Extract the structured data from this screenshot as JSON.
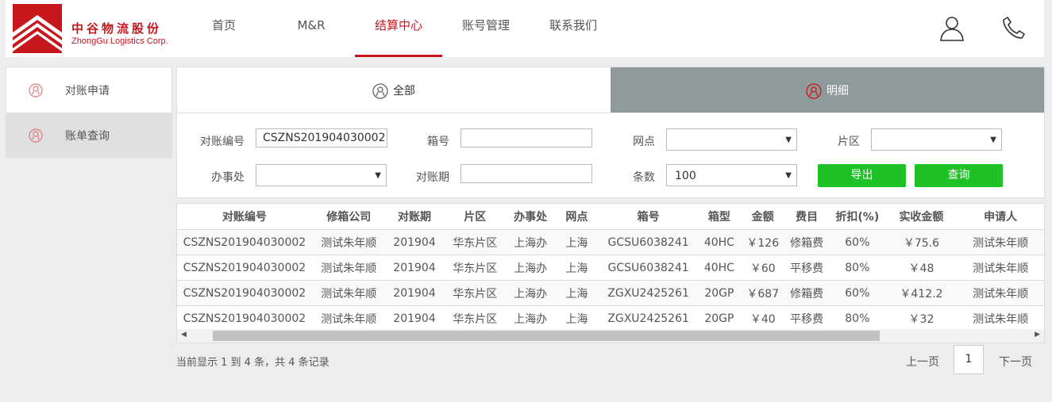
{
  "brand": {
    "name_cn": "中谷物流股份",
    "name_en": "ZhongGu Logistics Corp.",
    "color": "#c8161d"
  },
  "nav": {
    "items": [
      {
        "label": "首页"
      },
      {
        "label": "M&R"
      },
      {
        "label": "结算中心"
      },
      {
        "label": "账号管理"
      },
      {
        "label": "联系我们"
      }
    ],
    "active_index": 2
  },
  "header_icons": [
    "user-icon",
    "phone-icon"
  ],
  "sidebar": {
    "items": [
      {
        "label": "对账申请",
        "icon": "person-icon"
      },
      {
        "label": "账单查询",
        "icon": "person-icon"
      }
    ],
    "active_index": 1
  },
  "tabs": [
    {
      "label": "全部"
    },
    {
      "label": "明细"
    }
  ],
  "active_tab": 1,
  "filters": {
    "recon_no": {
      "label": "对账编号",
      "value": "CSZNS201904030002"
    },
    "box_no": {
      "label": "箱号",
      "value": ""
    },
    "outlet": {
      "label": "网点",
      "value": ""
    },
    "area": {
      "label": "片区",
      "value": ""
    },
    "office": {
      "label": "办事处",
      "value": ""
    },
    "period": {
      "label": "对账期",
      "value": ""
    },
    "count": {
      "label": "条数",
      "value": "100"
    },
    "export_label": "导出",
    "query_label": "查询"
  },
  "table": {
    "columns": [
      "对账编号",
      "修箱公司",
      "对账期",
      "片区",
      "办事处",
      "网点",
      "箱号",
      "箱型",
      "金额",
      "费目",
      "折扣(%)",
      "实收金额",
      "申请人"
    ],
    "rows": [
      [
        "CSZNS201904030002",
        "测试朱年顺",
        "201904",
        "华东片区",
        "上海办",
        "上海",
        "GCSU6038241",
        "40HC",
        "￥126",
        "修箱费",
        "60%",
        "￥75.6",
        "测试朱年顺"
      ],
      [
        "CSZNS201904030002",
        "测试朱年顺",
        "201904",
        "华东片区",
        "上海办",
        "上海",
        "GCSU6038241",
        "40HC",
        "￥60",
        "平移费",
        "80%",
        "￥48",
        "测试朱年顺"
      ],
      [
        "CSZNS201904030002",
        "测试朱年顺",
        "201904",
        "华东片区",
        "上海办",
        "上海",
        "ZGXU2425261",
        "20GP",
        "￥687",
        "修箱费",
        "60%",
        "￥412.2",
        "测试朱年顺"
      ],
      [
        "CSZNS201904030002",
        "测试朱年顺",
        "201904",
        "华东片区",
        "上海办",
        "上海",
        "ZGXU2425261",
        "20GP",
        "￥40",
        "平移费",
        "80%",
        "￥32",
        "测试朱年顺"
      ]
    ]
  },
  "pagination": {
    "summary": "当前显示 1 到 4 条，共 4 条记录",
    "prev_label": "上一页",
    "next_label": "下一页",
    "current_page": "1"
  },
  "colors": {
    "accent": "#c8161d",
    "button_green": "#1ec126",
    "tab_inactive": "#8f9a9a",
    "background": "#ebedef"
  }
}
